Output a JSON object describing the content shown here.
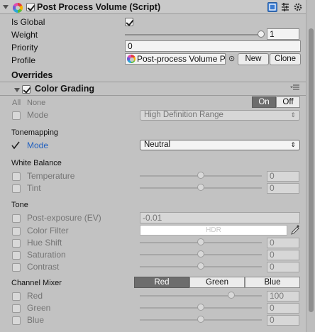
{
  "component": {
    "title": "Post Process Volume (Script)",
    "is_global_label": "Is Global",
    "is_global": true,
    "weight_label": "Weight",
    "weight_value": "1",
    "weight_fraction": 1.0,
    "priority_label": "Priority",
    "priority_value": "0",
    "profile_label": "Profile",
    "profile_value": "Post-process Volume P",
    "profile_picker_glyph": "⊙",
    "new_label": "New",
    "clone_label": "Clone"
  },
  "overrides_label": "Overrides",
  "color_grading": {
    "title": "Color Grading",
    "all_label": "All",
    "none_label": "None",
    "on_label": "On",
    "off_label": "Off",
    "mode_row": {
      "label": "Mode",
      "value": "High Definition Range",
      "dropdown_arrow": "⇕"
    },
    "tonemapping": {
      "section": "Tonemapping",
      "mode_label": "Mode",
      "mode_value": "Neutral",
      "mode_checked": true,
      "dropdown_arrow": "⇕"
    },
    "white_balance": {
      "section": "White Balance",
      "rows": [
        {
          "label": "Temperature",
          "value": "0",
          "fraction": 0.5
        },
        {
          "label": "Tint",
          "value": "0",
          "fraction": 0.5
        }
      ]
    },
    "tone": {
      "section": "Tone",
      "post_exposure_label": "Post-exposure (EV)",
      "post_exposure_value": "-0.01",
      "color_filter_label": "Color Filter",
      "color_filter_badge": "HDR",
      "color_filter_swatch": "#ffffff",
      "rows": [
        {
          "label": "Hue Shift",
          "value": "0",
          "fraction": 0.5
        },
        {
          "label": "Saturation",
          "value": "0",
          "fraction": 0.5
        },
        {
          "label": "Contrast",
          "value": "0",
          "fraction": 0.5
        }
      ]
    },
    "channel_mixer": {
      "section": "Channel Mixer",
      "tabs": [
        "Red",
        "Green",
        "Blue"
      ],
      "selected_tab": "Red",
      "rows": [
        {
          "label": "Red",
          "value": "100",
          "fraction": 0.75
        },
        {
          "label": "Green",
          "value": "0",
          "fraction": 0.5
        },
        {
          "label": "Blue",
          "value": "0",
          "fraction": 0.5
        }
      ]
    }
  },
  "icons": {
    "fold": "fold-arrow",
    "help": "book-icon",
    "settings": "sliders-icon",
    "menu": "gear-icon",
    "eyedropper": "eyedropper-icon",
    "overflow": "list-icon"
  },
  "colors": {
    "accent_blue": "#1f5fbf",
    "selected_segment": "#6d6d6d",
    "panel": "#c2c2c2"
  }
}
